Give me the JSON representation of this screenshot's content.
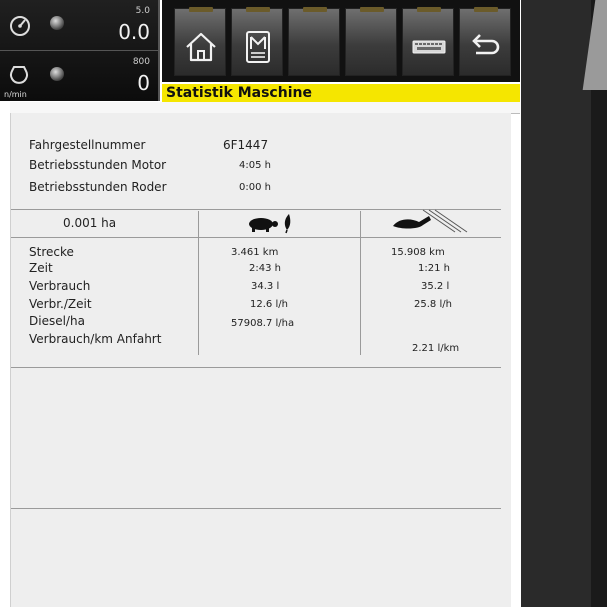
{
  "gauges": {
    "speed": {
      "max": "5.0",
      "value": "0.0"
    },
    "rpm": {
      "max": "800",
      "value": "0",
      "unit": "n/min"
    }
  },
  "toolbar": {
    "buttons": [
      "home-icon",
      "machine-menu-icon",
      "empty-1",
      "empty-2",
      "keyboard-icon",
      "back-arrow-icon"
    ]
  },
  "title": "Statistik Maschine",
  "info": [
    {
      "label": "Fahrgestellnummer",
      "value": "6F1447"
    },
    {
      "label": "Betriebsstunden Motor",
      "value": "4:05 h"
    },
    {
      "label": "Betriebsstunden Roder",
      "value": "0:00 h"
    }
  ],
  "table": {
    "area": "0.001 ha",
    "rows": [
      {
        "label": "Strecke",
        "work": "3.461  km",
        "road": "15.908  km"
      },
      {
        "label": "Zeit",
        "work": "2:43  h",
        "road": "1:21  h"
      },
      {
        "label": "Verbrauch",
        "work": "34.3  l",
        "road": "35.2  l"
      },
      {
        "label": "Verbr./Zeit",
        "work": "12.6  l/h",
        "road": "25.8  l/h"
      },
      {
        "label": "Diesel/ha",
        "work": "57908.7  l/ha",
        "road": ""
      },
      {
        "label": "Verbrauch/km Anfahrt",
        "work": "",
        "road": "2.21  l/km"
      }
    ]
  }
}
